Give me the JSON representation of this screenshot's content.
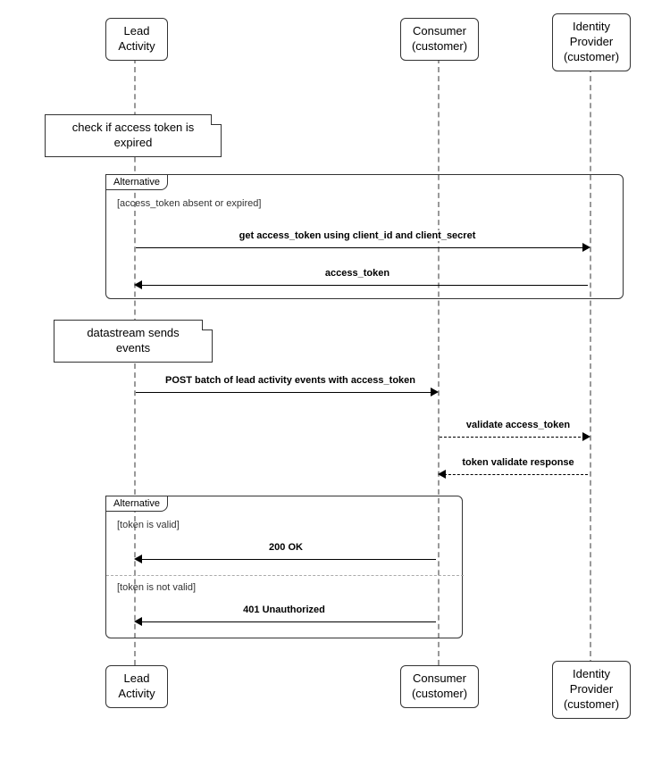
{
  "participants": {
    "p1": "Lead\nActivity",
    "p2": "Consumer\n(customer)",
    "p3": "Identity\nProvider\n(customer)"
  },
  "notes": {
    "n1": "check if access token is\nexpired",
    "n2": "datastream sends\nevents"
  },
  "alt": {
    "label": "Alternative",
    "cond1": "[access_token absent or expired]",
    "cond2": "[token is valid]",
    "cond3": "[token is not valid]"
  },
  "messages": {
    "m1": "get access_token using client_id and client_secret",
    "m2": "access_token",
    "m3": "POST batch of lead activity events with access_token",
    "m4": "validate access_token",
    "m5": "token validate response",
    "m6": "200 OK",
    "m7": "401 Unauthorized"
  },
  "chart_data": {
    "type": "sequence_diagram",
    "participants": [
      "Lead Activity",
      "Consumer (customer)",
      "Identity Provider (customer)"
    ],
    "flow": [
      {
        "type": "note",
        "at": "Lead Activity",
        "text": "check if access token is expired"
      },
      {
        "type": "alt",
        "label": "Alternative",
        "guards": [
          "access_token absent or expired"
        ],
        "contents": [
          [
            {
              "type": "message",
              "from": "Lead Activity",
              "to": "Identity Provider (customer)",
              "text": "get access_token using client_id and client_secret",
              "style": "solid"
            },
            {
              "type": "message",
              "from": "Identity Provider (customer)",
              "to": "Lead Activity",
              "text": "access_token",
              "style": "solid"
            }
          ]
        ]
      },
      {
        "type": "note",
        "at": "Lead Activity",
        "text": "datastream sends events"
      },
      {
        "type": "message",
        "from": "Lead Activity",
        "to": "Consumer (customer)",
        "text": "POST batch of lead activity events with access_token",
        "style": "solid"
      },
      {
        "type": "message",
        "from": "Consumer (customer)",
        "to": "Identity Provider (customer)",
        "text": "validate access_token",
        "style": "dashed"
      },
      {
        "type": "message",
        "from": "Identity Provider (customer)",
        "to": "Consumer (customer)",
        "text": "token validate response",
        "style": "dashed"
      },
      {
        "type": "alt",
        "label": "Alternative",
        "guards": [
          "token is valid",
          "token is not valid"
        ],
        "contents": [
          [
            {
              "type": "message",
              "from": "Consumer (customer)",
              "to": "Lead Activity",
              "text": "200 OK",
              "style": "solid"
            }
          ],
          [
            {
              "type": "message",
              "from": "Consumer (customer)",
              "to": "Lead Activity",
              "text": "401 Unauthorized",
              "style": "solid"
            }
          ]
        ]
      }
    ]
  }
}
